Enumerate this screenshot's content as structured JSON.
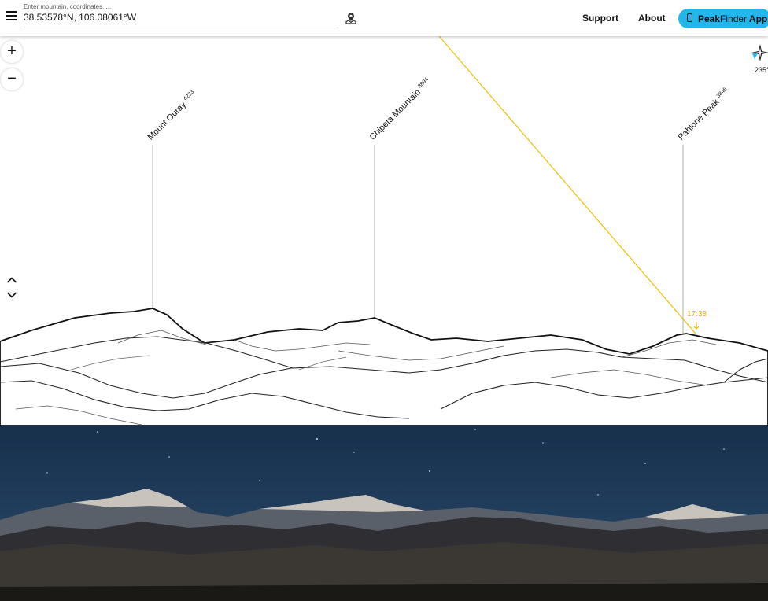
{
  "header": {
    "search_hint": "Enter mountain, coordinates, ...",
    "search_value": "38.53578°N, 106.08061°W",
    "support_label": "Support",
    "about_label": "About",
    "app_button": {
      "part1": "Peak",
      "part2": "Finder",
      "part3": " App"
    }
  },
  "controls": {
    "zoom_in": "+",
    "zoom_out": "−",
    "heading": "235°"
  },
  "peaks": [
    {
      "name": "Mount Ouray",
      "elevation": "4233"
    },
    {
      "name": "Chipeta Mountain",
      "elevation": "3894"
    },
    {
      "name": "Pahlone Peak",
      "elevation": "3845"
    }
  ],
  "sun": {
    "time": "17:38"
  },
  "colors": {
    "accent": "#22b7ec",
    "sun_path": "#f0c000",
    "sky": "#1b3350"
  }
}
